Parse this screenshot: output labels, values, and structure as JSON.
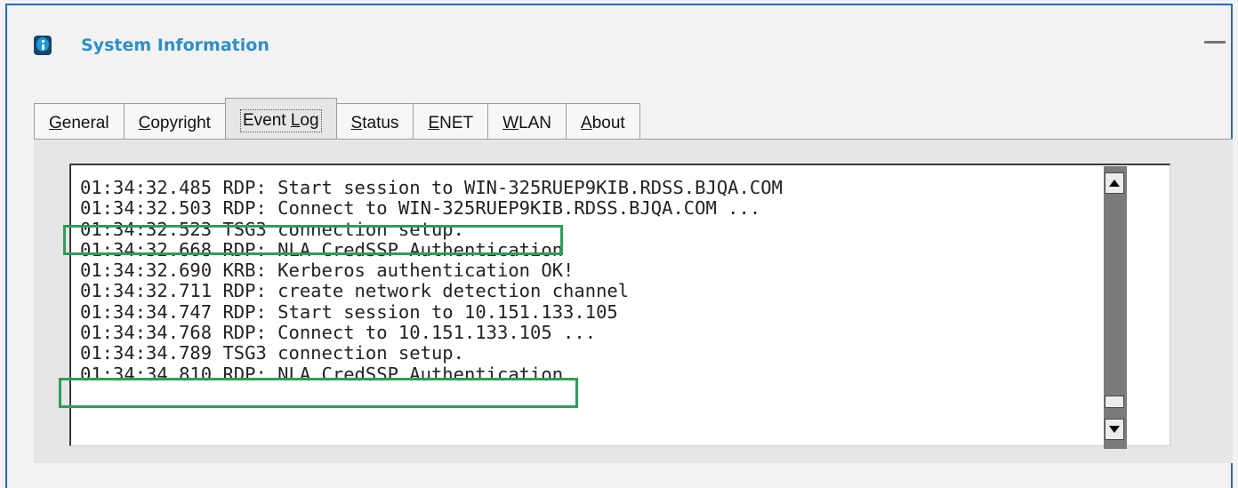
{
  "window": {
    "title": "System Information"
  },
  "tabs": [
    {
      "label": "General",
      "mnemonic": "G",
      "rest": "eneral",
      "active": false
    },
    {
      "label": "Copyright",
      "mnemonic": "C",
      "rest": "opyright",
      "active": false
    },
    {
      "label": "Event Log",
      "prefix": "Event ",
      "mnemonic": "L",
      "rest": "og",
      "active": true
    },
    {
      "label": "Status",
      "mnemonic": "S",
      "rest": "tatus",
      "active": false
    },
    {
      "label": "ENET",
      "mnemonic": "E",
      "rest": "NET",
      "active": false
    },
    {
      "label": "WLAN",
      "mnemonic": "W",
      "rest": "LAN",
      "active": false
    },
    {
      "label": "About",
      "mnemonic": "A",
      "rest": "bout",
      "active": false
    }
  ],
  "event_log": {
    "lines": [
      "01:34:32.485 RDP: Start session to WIN-325RUEP9KIB.RDSS.BJQA.COM",
      "01:34:32.503 RDP: Connect to WIN-325RUEP9KIB.RDSS.BJQA.COM ...",
      "01:34:32.523 TSG3 connection setup.",
      "01:34:32.668 RDP: NLA CredSSP Authentication",
      "01:34:32.690 KRB: Kerberos authentication OK!",
      "01:34:32.711 RDP: create network detection channel",
      "01:34:34.747 RDP: Start session to 10.151.133.105",
      "01:34:34.768 RDP: Connect to 10.151.133.105 ...",
      "01:34:34.789 TSG3 connection setup.",
      "01:34:34.810 RDP: NLA CredSSP Authentication"
    ],
    "highlighted_lines": [
      2,
      8
    ],
    "highlight_color": "#2e9e57"
  },
  "icons": {
    "title": "info-icon",
    "scroll_up": "arrow-up-icon",
    "scroll_down": "arrow-down-icon",
    "minimize": "minimize-icon"
  }
}
